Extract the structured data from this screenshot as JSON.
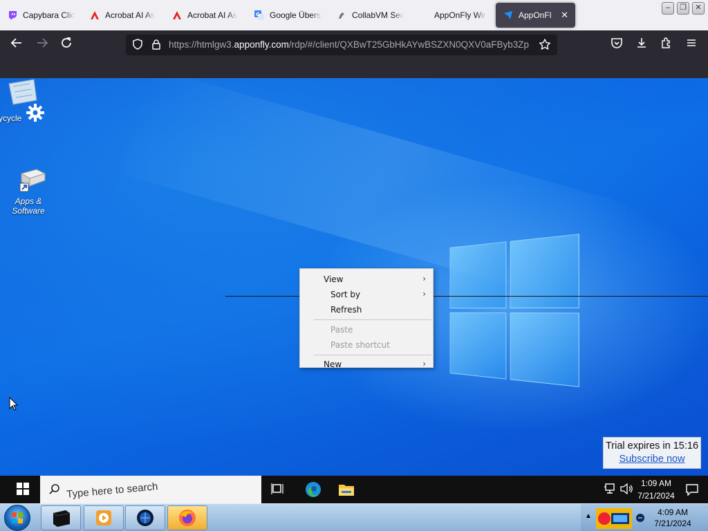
{
  "browser": {
    "tabs": [
      {
        "label": "Capybara Clic",
        "icon": "twitch-icon",
        "active": false
      },
      {
        "label": "Acrobat AI As",
        "icon": "acrobat-icon",
        "active": false
      },
      {
        "label": "Acrobat AI As",
        "icon": "acrobat-icon",
        "active": false
      },
      {
        "label": "Google Überse",
        "icon": "google-translate-icon",
        "active": false
      },
      {
        "label": "CollabVM Sea",
        "icon": "collabvm-icon",
        "active": false
      },
      {
        "label": "AppOnFly Wir",
        "icon": "apponfly-icon",
        "active": false
      },
      {
        "label": "AppOnFly",
        "icon": "apponfly-icon",
        "active": true
      }
    ],
    "url_prefix": "https://htmlgw3.",
    "url_domain": "apponfly.com",
    "url_rest": "/rdp/#/client/QXBwT25GbHkAYwBSZXN0QXV0aFByb3Zp",
    "accent": "#1e90ff"
  },
  "remote_desktop": {
    "icons": [
      {
        "label": "ycycle",
        "icon": "recycle-bin-icon"
      },
      {
        "label": "Apps &\nSoftware",
        "icon": "apps-software-icon"
      }
    ],
    "context_menu": {
      "items": [
        {
          "label": "View",
          "submenu": true,
          "disabled": false
        },
        {
          "label": "Sort by",
          "submenu": true,
          "disabled": false
        },
        {
          "label": "Refresh",
          "submenu": false,
          "disabled": false
        },
        {
          "label": "Paste",
          "submenu": false,
          "disabled": true
        },
        {
          "label": "Paste shortcut",
          "submenu": false,
          "disabled": true
        },
        {
          "label": "New",
          "submenu": true,
          "disabled": false
        }
      ]
    },
    "trial": {
      "text": "Trial expires in 15:16",
      "link": "Subscribe now"
    },
    "taskbar": {
      "search_placeholder": "Type here to search",
      "time": "1:09 AM",
      "date": "7/21/2024"
    }
  },
  "host_taskbar": {
    "apps": [
      "terminal-app",
      "media-player-app",
      "bluebox-app",
      "firefox-app"
    ],
    "time": "4:09 AM",
    "date": "7/21/2024"
  }
}
